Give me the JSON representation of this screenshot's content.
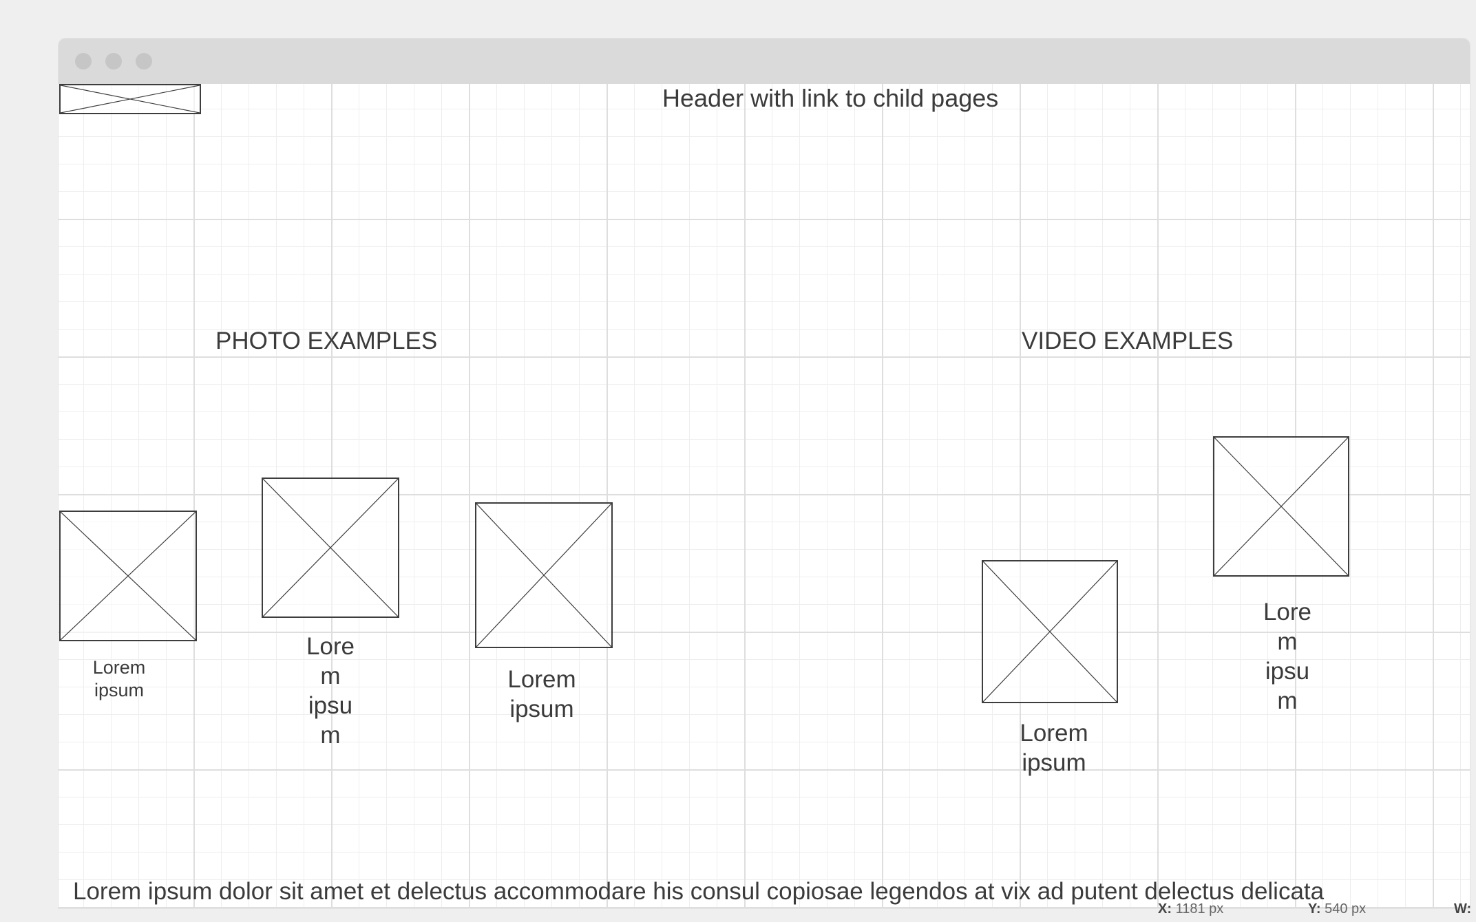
{
  "header": {
    "title": "Header with link to child pages"
  },
  "sections": {
    "photo_title": "PHOTO EXAMPLES",
    "video_title": "VIDEO EXAMPLES"
  },
  "photos": [
    {
      "caption": "Lorem\nipsum"
    },
    {
      "caption": "Lore\nm\nipsu\nm"
    },
    {
      "caption": "Lorem\nipsum"
    }
  ],
  "videos": [
    {
      "caption": "Lorem\nipsum"
    },
    {
      "caption": "Lore\nm\nipsu\nm"
    }
  ],
  "footer": {
    "text": "Lorem ipsum dolor sit amet et delectus accommodare his consul copiosae legendos at vix ad putent delectus delicata"
  },
  "status_bar": {
    "x_label": "X:",
    "x_value": "1181 px",
    "y_label": "Y:",
    "y_value": "540 px",
    "w_label": "W:"
  },
  "colors": {
    "stroke": "#3d3d3d",
    "text": "#3b3b3b",
    "titlebar": "#dadada",
    "background": "#efefef"
  }
}
